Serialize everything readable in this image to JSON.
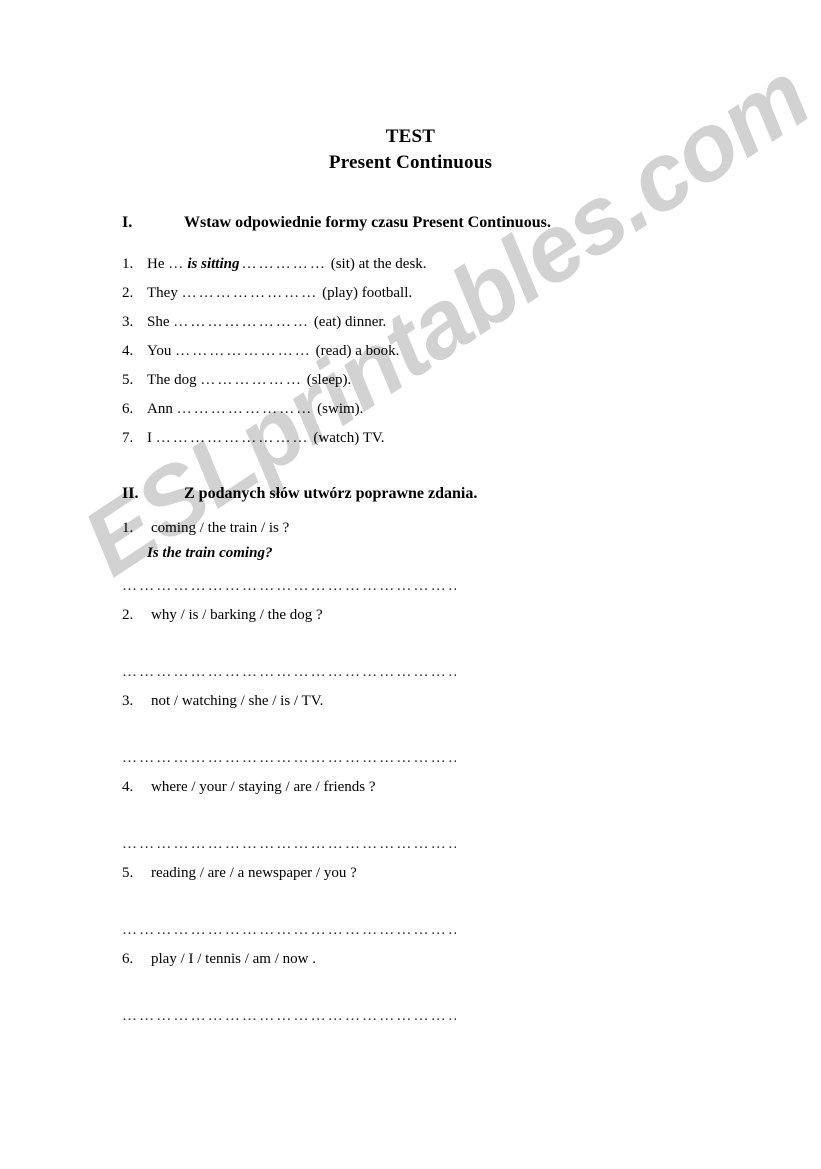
{
  "watermark": {
    "text": "ESLprintables.com",
    "color": "#d2d2d2"
  },
  "title": {
    "line1": "TEST",
    "line2": "Present Continuous"
  },
  "sections": [
    {
      "numeral": "I.",
      "heading": "Wstaw odpowiednie formy czasu Present Continuous.",
      "items": [
        {
          "num": "1.",
          "subject": "He",
          "lead_dots": "…",
          "answer": "is sitting",
          "dots": "……………",
          "verb": "(sit) at the desk."
        },
        {
          "num": "2.",
          "subject": "They",
          "lead_dots": "",
          "answer": "",
          "dots": "……………………",
          "verb": "(play) football."
        },
        {
          "num": "3.",
          "subject": "She",
          "lead_dots": "",
          "answer": "",
          "dots": "……………………",
          "verb": "(eat) dinner."
        },
        {
          "num": "4.",
          "subject": "You",
          "lead_dots": "",
          "answer": "",
          "dots": "……………………",
          "verb": "(read) a book."
        },
        {
          "num": "5.",
          "subject": "The dog",
          "lead_dots": "",
          "answer": "",
          "dots": "………………",
          "verb": "(sleep)."
        },
        {
          "num": "6.",
          "subject": "Ann",
          "lead_dots": "",
          "answer": "",
          "dots": "……………………",
          "verb": "(swim)."
        },
        {
          "num": "7.",
          "subject": "I",
          "lead_dots": "",
          "answer": "",
          "dots": "………………………",
          "verb": "(watch) TV."
        }
      ]
    },
    {
      "numeral": "II.",
      "heading": "Z podanych słów utwórz poprawne zdania.",
      "items": [
        {
          "num": "1.",
          "prompt": "coming / the train / is ?",
          "sample_answer": "Is the train coming?"
        },
        {
          "num": "2.",
          "prompt": "why / is / barking / the dog  ?",
          "sample_answer": ""
        },
        {
          "num": "3.",
          "prompt": "not / watching / she / is / TV.",
          "sample_answer": ""
        },
        {
          "num": "4.",
          "prompt": "where / your / staying / are / friends ?",
          "sample_answer": ""
        },
        {
          "num": "5.",
          "prompt": "reading / are / a newspaper / you ?",
          "sample_answer": ""
        },
        {
          "num": "6.",
          "prompt": "play / I / tennis / am / now .",
          "sample_answer": ""
        }
      ],
      "answer_line_dots": "……………………………………………………………………………"
    }
  ]
}
